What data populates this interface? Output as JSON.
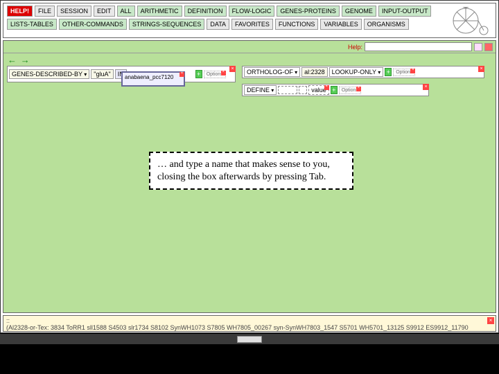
{
  "menu_row1": [
    "HELP!",
    "FILE",
    "SESSION",
    "EDIT",
    "ALL",
    "ARITHMETIC",
    "DEFINITION",
    "FLOW-LOGIC",
    "GENES-PROTEINS",
    "GENOME",
    "INPUT-OUTPUT"
  ],
  "menu_row2": [
    "LISTS-TABLES",
    "OTHER-COMMANDS",
    "STRINGS-SEQUENCES",
    "DATA",
    "FAVORITES",
    "FUNCTIONS",
    "VARIABLES",
    "ORGANISMS"
  ],
  "help_label": "Help:",
  "expr1": {
    "fn": "GENES-DESCRIBED-BY",
    "arg": "\"gluA\"",
    "in": "IN",
    "org": "anabaena_pcc7120"
  },
  "expr2": {
    "fn": "ORTHOLOG-OF",
    "arg": "al:2328",
    "mode": "LOOKUP-ONLY"
  },
  "expr3": {
    "fn": "DEFINE",
    "val": "value"
  },
  "options_label": "Options",
  "tooltip_text": "… and type a name that makes sense to you, closing the box afterwards by pressing Tab.",
  "bottom_prompt": "::",
  "bottom_text": "(Al2328-or-Tex: 3834 ToRR1 sll1588 S4503 slr1734 S8102 SynWH1073 S7805 WH7805_00267 syn-SynWH7803_1547 S5701 WH5701_13125 S9912 ES9912_11790"
}
